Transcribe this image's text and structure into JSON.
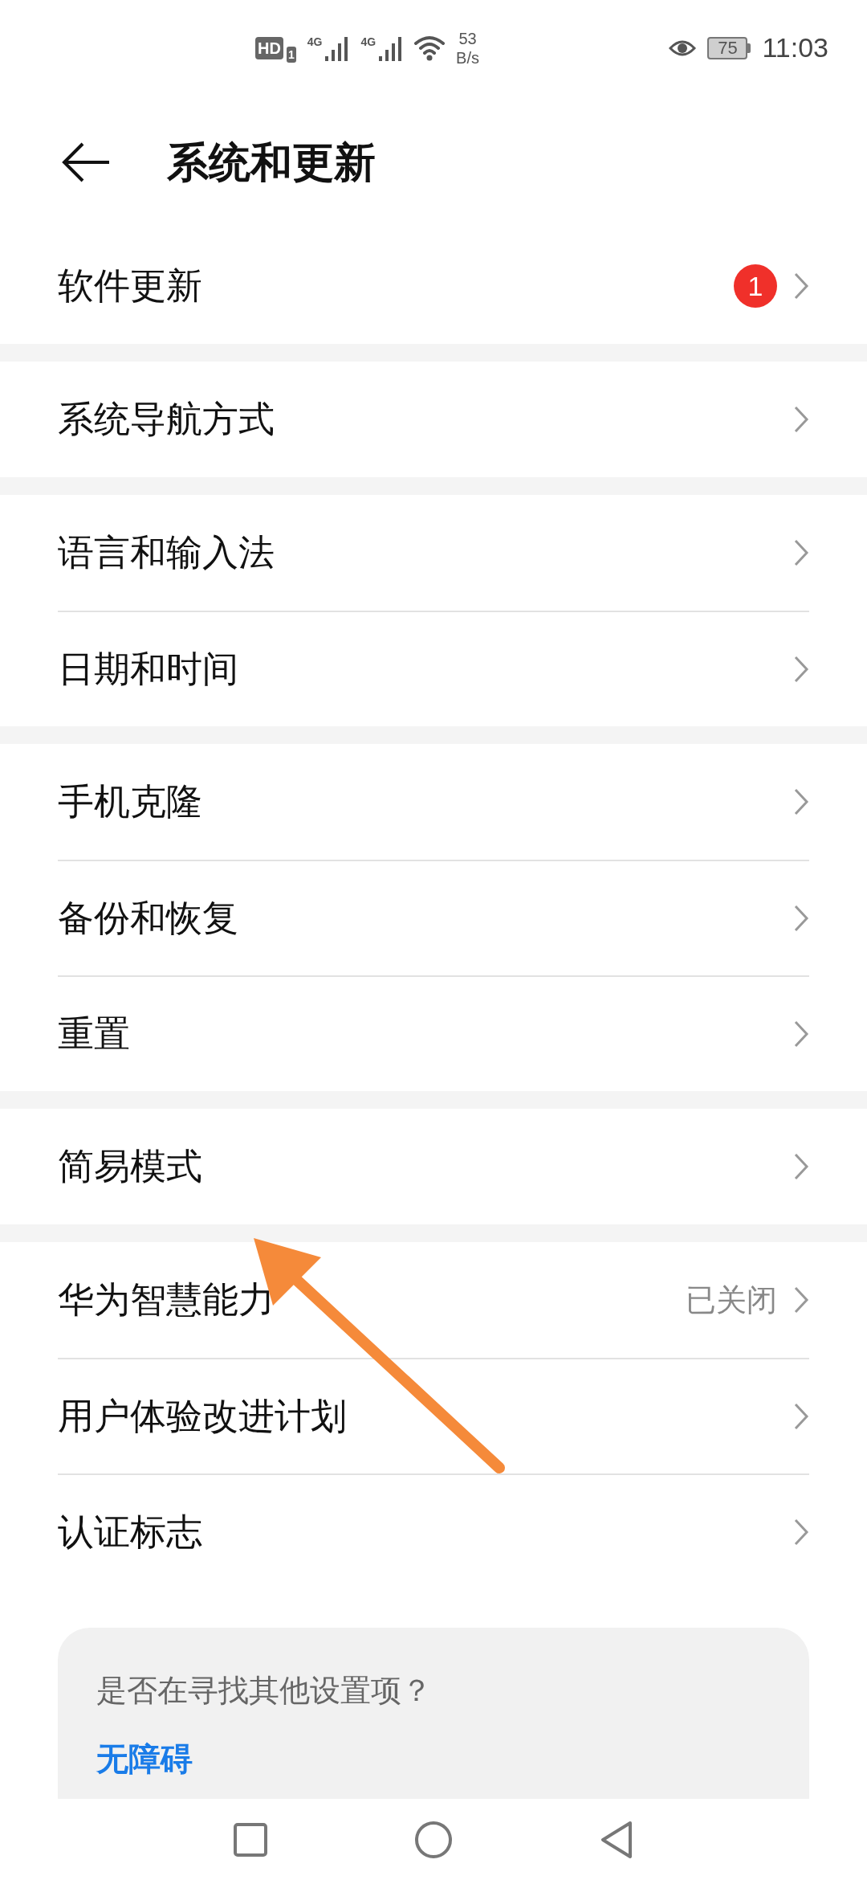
{
  "status_bar": {
    "hd": "HD",
    "sim": "1",
    "networks": [
      "4G",
      "4G"
    ],
    "speed_value": "53",
    "speed_unit": "B/s",
    "battery": "75",
    "time": "11:03"
  },
  "header": {
    "title": "系统和更新"
  },
  "sections": [
    {
      "items": [
        {
          "label": "软件更新",
          "badge": "1"
        }
      ]
    },
    {
      "items": [
        {
          "label": "系统导航方式"
        }
      ]
    },
    {
      "items": [
        {
          "label": "语言和输入法"
        },
        {
          "label": "日期和时间"
        }
      ]
    },
    {
      "items": [
        {
          "label": "手机克隆"
        },
        {
          "label": "备份和恢复"
        },
        {
          "label": "重置"
        }
      ]
    },
    {
      "items": [
        {
          "label": "简易模式"
        }
      ]
    },
    {
      "items": [
        {
          "label": "华为智慧能力",
          "value": "已关闭"
        },
        {
          "label": "用户体验改进计划"
        },
        {
          "label": "认证标志"
        }
      ]
    }
  ],
  "suggestion_card": {
    "question": "是否在寻找其他设置项？",
    "link": "无障碍"
  }
}
